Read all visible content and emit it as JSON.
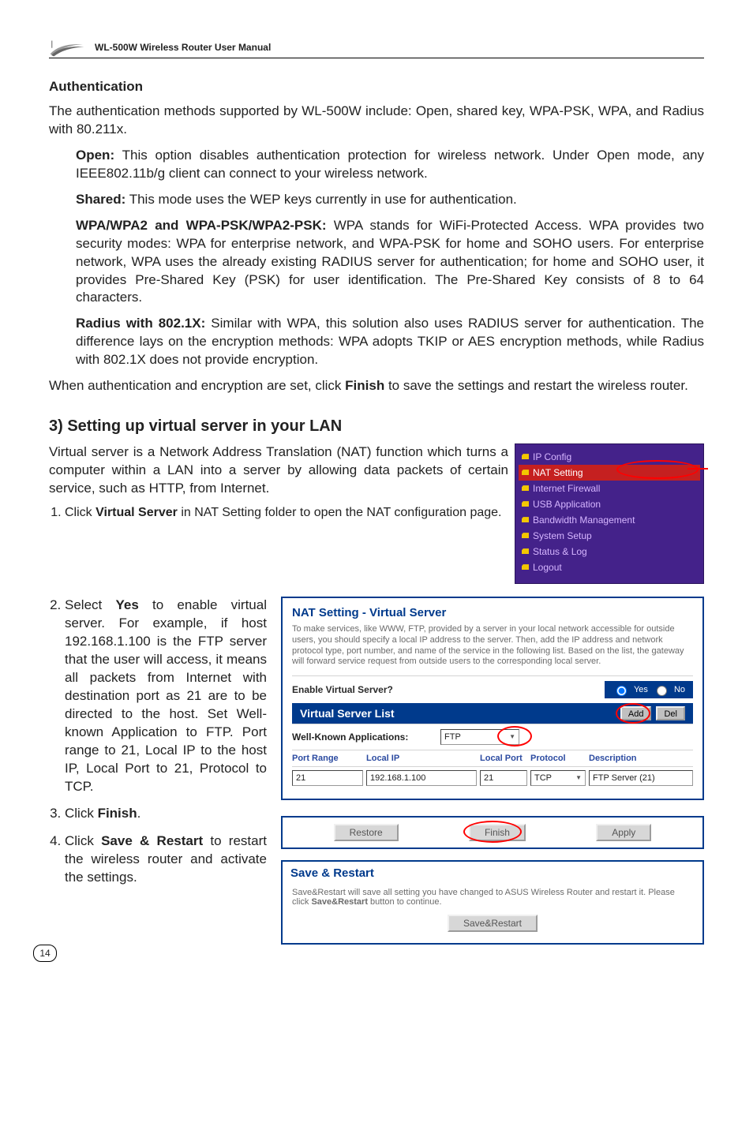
{
  "header": {
    "title": "WL-500W Wireless Router User Manual"
  },
  "auth": {
    "heading": "Authentication",
    "intro": "The authentication methods supported by WL-500W include: Open, shared key, WPA-PSK, WPA, and Radius with 80.211x.",
    "open_label": "Open:",
    "open_text": " This option disables authentication protection for wireless network. Under Open mode, any IEEE802.11b/g client can connect to your wireless network.",
    "shared_label": "Shared:",
    "shared_text": " This mode uses the WEP keys currently in use for authentication.",
    "wpa_label": "WPA/WPA2 and WPA-PSK/WPA2-PSK:",
    "wpa_text": " WPA stands for WiFi-Protected Access. WPA provides two security modes: WPA for enterprise network, and WPA-PSK for home and SOHO users. For enterprise network, WPA uses the already existing RADIUS server for authentication; for home and SOHO user, it provides Pre-Shared Key (PSK) for user identification. The Pre-Shared Key consists of 8 to 64 characters.",
    "radius_label": "Radius with 802.1X:",
    "radius_text": " Similar with WPA, this solution also uses RADIUS server for authentication. The difference lays on the encryption methods: WPA adopts TKIP or AES encryption methods, while Radius with 802.1X does not provide encryption.",
    "closing_prefix": "When authentication and encryption are set, click ",
    "closing_bold": "Finish",
    "closing_suffix": " to save the settings and restart the wireless router."
  },
  "section3": {
    "heading": "3) Setting up virtual server in your LAN",
    "para1": "Virtual server is a Network Address Translation (NAT) function which turns a computer within a LAN into a server by allowing data packets of certain service, such as HTTP, from Internet.",
    "step1_pre": "Click ",
    "step1_bold": "Virtual Server",
    "step1_post": " in NAT Setting folder to open the NAT configuration page.",
    "step2_pre": "Select ",
    "step2_bold": "Yes",
    "step2_post": " to enable virtual server. For example, if host 192.168.1.100 is the FTP server that the user will access, it means all packets from Internet with destination port as 21 are to be directed to the host. Set Well-known Application to FTP. Port range to 21, Local IP to the host IP, Local Port to 21, Protocol to TCP.",
    "step3_pre": "Click ",
    "step3_bold": "Finish",
    "step3_post": ".",
    "step4_pre": "Click ",
    "step4_bold": "Save & Restart",
    "step4_post": " to restart the wireless router and activate the settings."
  },
  "sidenav": {
    "items": [
      "IP Config",
      "NAT Setting",
      "Internet Firewall",
      "USB Application",
      "Bandwidth Management",
      "System Setup",
      "Status & Log",
      "Logout"
    ]
  },
  "nat_panel": {
    "title": "NAT Setting - Virtual Server",
    "blurb": "To make services, like WWW, FTP, provided by a server in your local network accessible for outside users, you should specify a local IP address to the server. Then, add the IP address and network protocol type, port number, and name of the service in the following list. Based on the list, the gateway will forward service request from outside users to the corresponding local server.",
    "enable_label": "Enable Virtual Server?",
    "radio_yes": "Yes",
    "radio_no": "No",
    "list_title": "Virtual Server List",
    "btn_add": "Add",
    "btn_del": "Del",
    "wka_label": "Well-Known Applications:",
    "wka_value": "FTP",
    "cols": {
      "port_range": "Port Range",
      "local_ip": "Local IP",
      "local_port": "Local Port",
      "protocol": "Protocol",
      "description": "Description"
    },
    "row": {
      "port_range": "21",
      "local_ip": "192.168.1.100",
      "local_port": "21",
      "protocol": "TCP",
      "description": "FTP Server (21)"
    }
  },
  "btn_row": {
    "restore": "Restore",
    "finish": "Finish",
    "apply": "Apply"
  },
  "save_panel": {
    "title": "Save & Restart",
    "body_prefix": "Save&Restart will save all setting you have changed to ASUS Wireless Router and restart it. Please click ",
    "body_bold": "Save&Restart",
    "body_suffix": " button to continue.",
    "button": "Save&Restart"
  },
  "page_number": "14"
}
